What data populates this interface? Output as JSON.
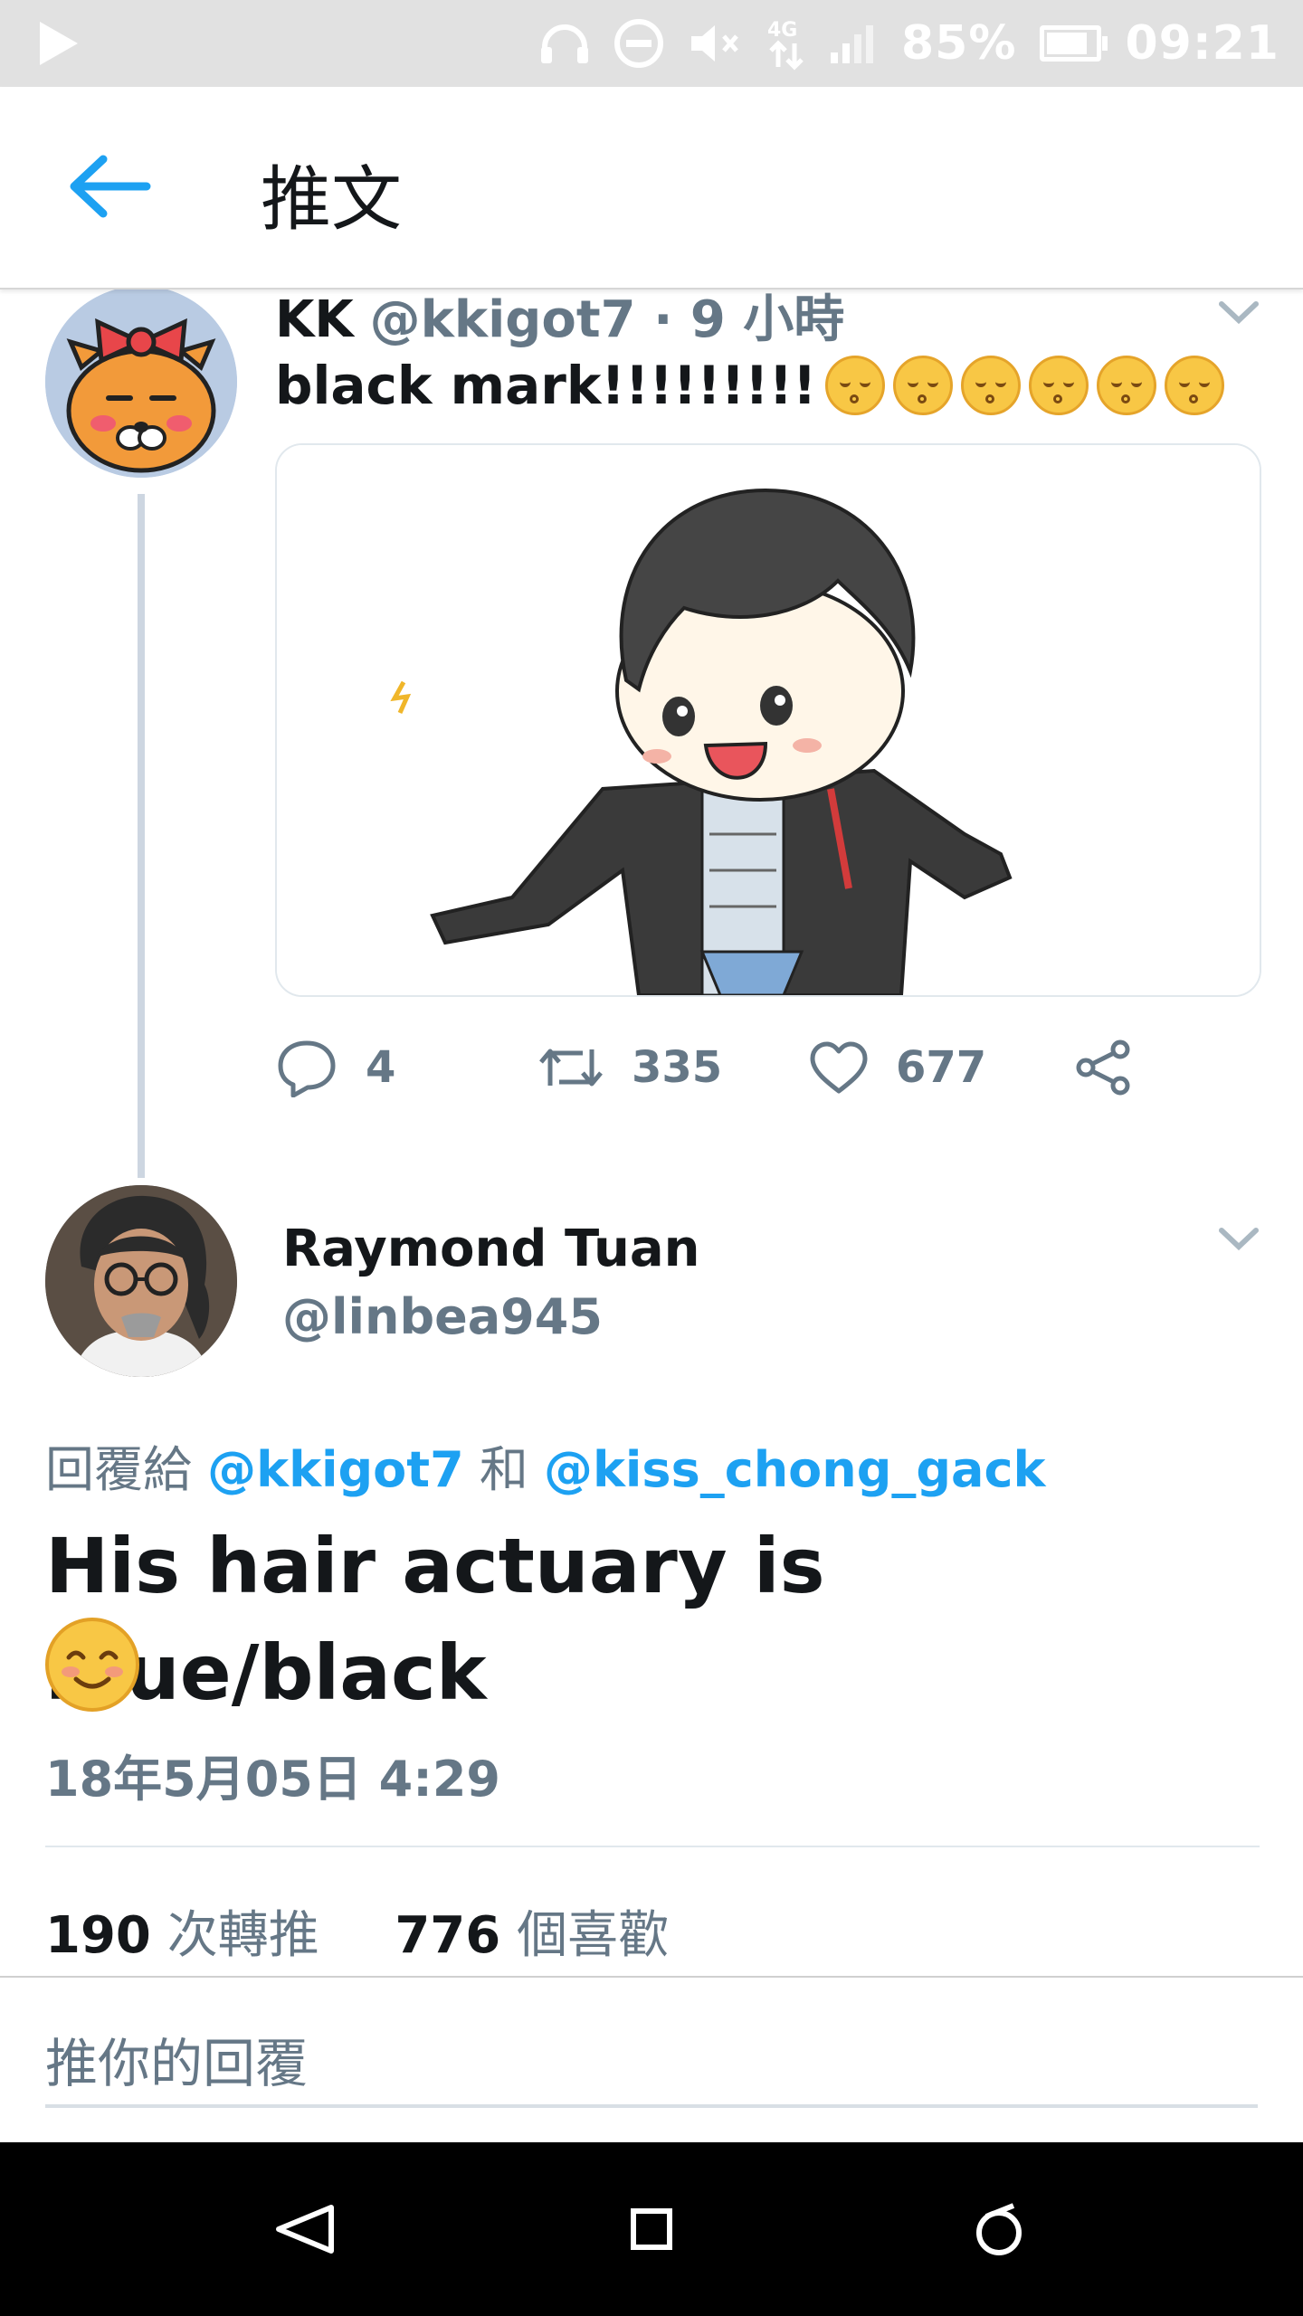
{
  "status_bar": {
    "battery": "85%",
    "time": "09:21",
    "network": "4G",
    "icons": [
      "play-icon",
      "headphones-icon",
      "do-not-disturb-icon",
      "mute-icon",
      "network-4g-icon",
      "signal-icon",
      "battery-icon"
    ]
  },
  "header": {
    "title": "推文",
    "back_icon": "back-arrow-icon"
  },
  "tweet1": {
    "name": "KK",
    "meta": "@kkigot7 · 9 小時",
    "text": "black mark!!!!!!!!!",
    "emoji_count": 6,
    "media_description": "chibi illustration",
    "actions": {
      "replies": "4",
      "retweets": "335",
      "likes": "677"
    }
  },
  "tweet2": {
    "name": "Raymond Tuan",
    "handle": "@linbea945",
    "reply_prefix": "回覆給",
    "reply_mention_1": "@kkigot7",
    "reply_joiner": "和",
    "reply_mention_2": "@kiss_chong_gack",
    "text": "His hair actuary is blue/black",
    "timestamp": "18年5月05日 4:29",
    "retweet_count": "190",
    "retweet_label": "次轉推",
    "like_count": "776",
    "like_label": "個喜歡"
  },
  "reply": {
    "placeholder": "推你的回覆"
  },
  "colors": {
    "accent": "#1da1f2",
    "secondary_text": "#657786",
    "primary_text": "#14171a",
    "status_bar": "#e1e1e1",
    "nav_bar": "#000000"
  }
}
